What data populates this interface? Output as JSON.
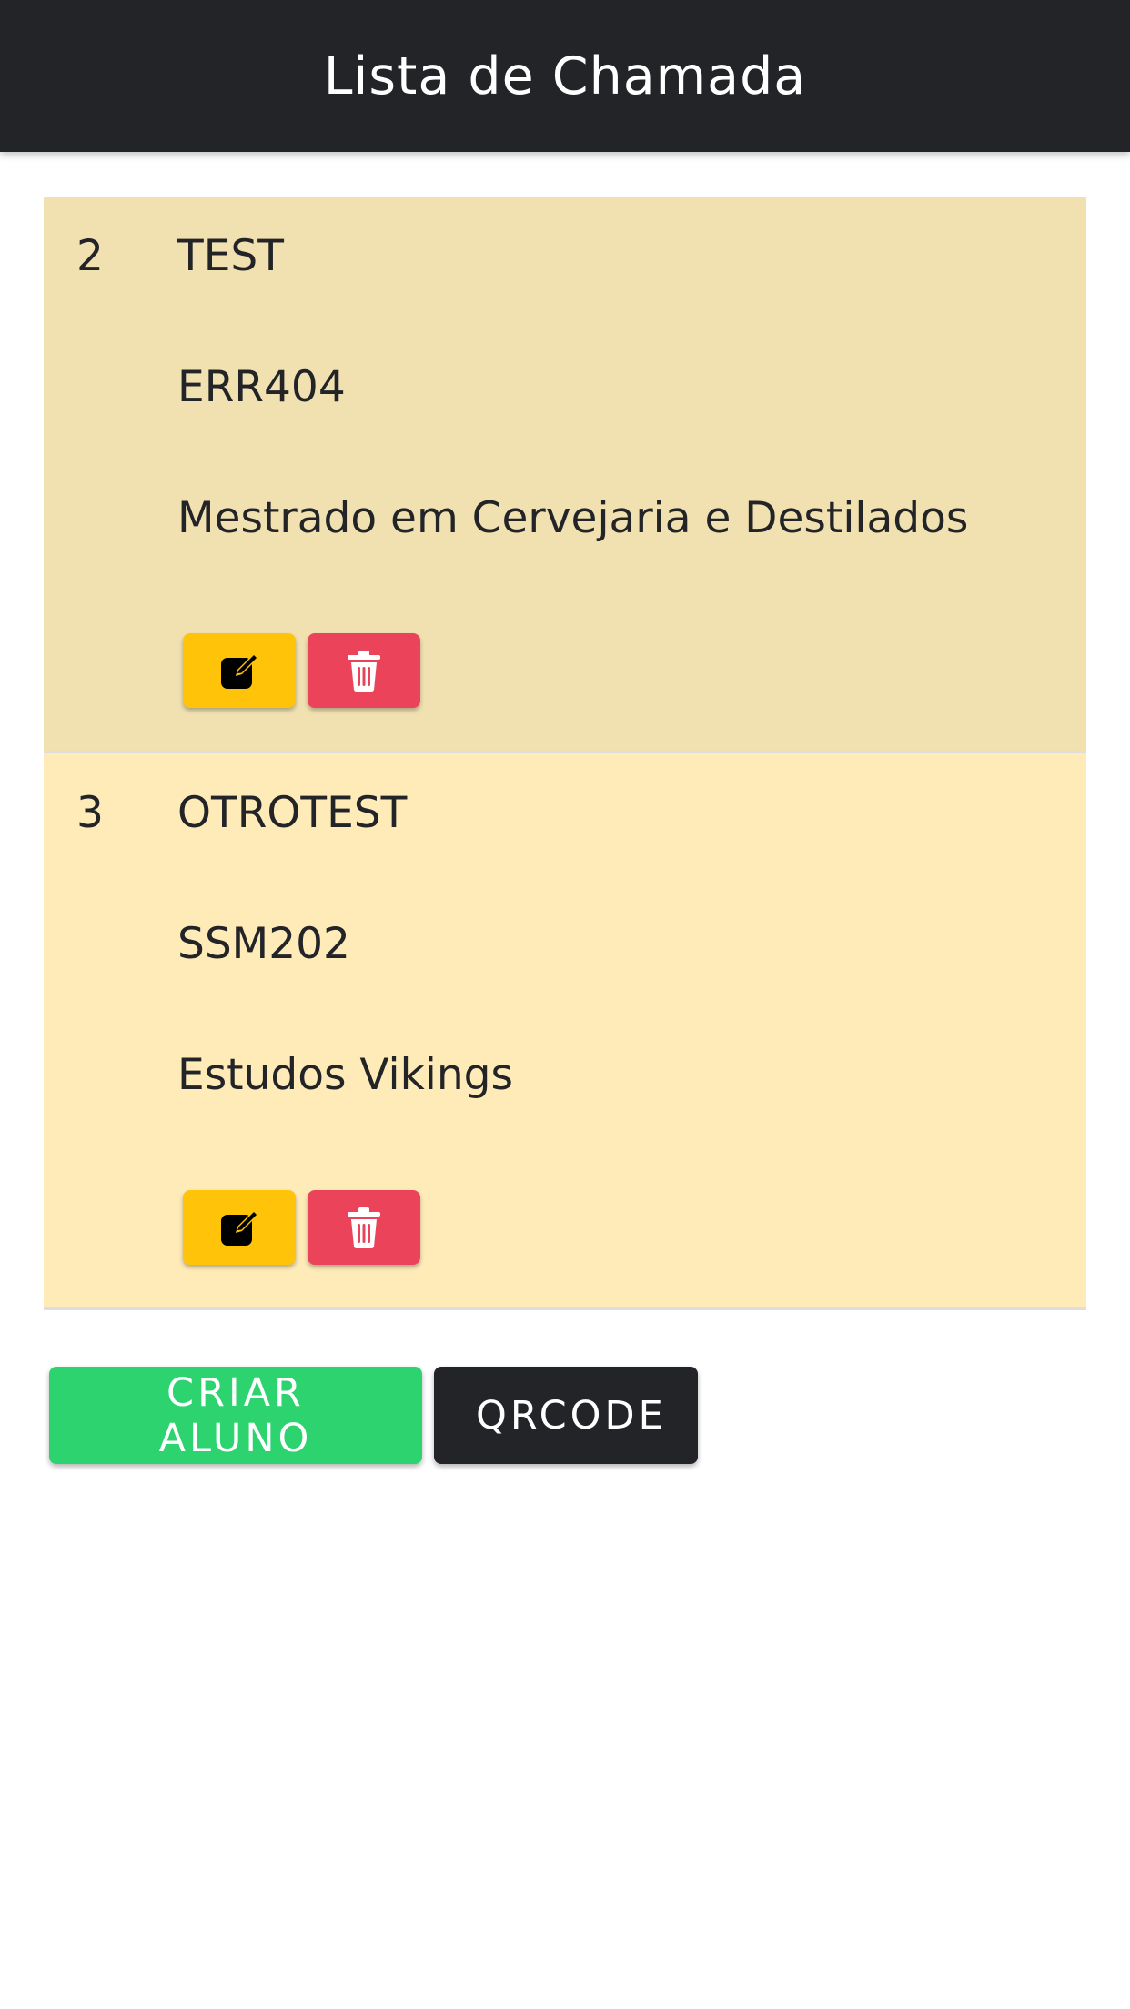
{
  "header": {
    "title": "Lista de Chamada"
  },
  "students": [
    {
      "number": "2",
      "name": "TEST",
      "code": "ERR404",
      "course": "Mestrado em Cervejaria e Destilados"
    },
    {
      "number": "3",
      "name": "OTROTEST",
      "code": "SSM202",
      "course": "Estudos Vikings"
    }
  ],
  "actions": {
    "create_label": "CRIAR ALUNO",
    "qrcode_label": "QRCODE"
  },
  "icons": {
    "edit": "edit-icon",
    "delete": "trash-icon"
  },
  "colors": {
    "toolbar": "#222428",
    "row_odd": "#f1e1b1",
    "row_even": "#feebb8",
    "edit_button": "#ffc409",
    "delete_button": "#eb445a",
    "create_button": "#2dd36f",
    "qrcode_button": "#222428"
  }
}
